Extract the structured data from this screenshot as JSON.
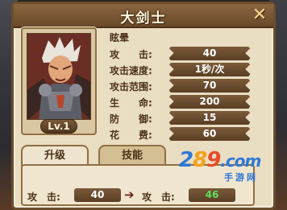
{
  "window": {
    "title": "大剑士",
    "close_symbol": "✕"
  },
  "hero": {
    "level": "Lv.1"
  },
  "skill": {
    "name": "眩晕"
  },
  "stats": [
    {
      "label": "攻　　击:",
      "value": "40"
    },
    {
      "label": "攻击速度:",
      "value": "1秒/次"
    },
    {
      "label": "攻击范围:",
      "value": "70"
    },
    {
      "label": "生　　命:",
      "value": "200"
    },
    {
      "label": "防　　御:",
      "value": "15"
    },
    {
      "label": "花　　费:",
      "value": "60"
    }
  ],
  "tabs": [
    {
      "label": "升级",
      "active": false
    },
    {
      "label": "技能",
      "active": true
    }
  ],
  "comparison": {
    "before_label": "攻　击:",
    "before_value": "40",
    "arrow": "➔",
    "after_label": "攻　击:",
    "after_value": "46",
    "after_color": "#5fe05a"
  },
  "watermark": {
    "logo_a": "2",
    "logo_b": "8",
    "logo_c": "9",
    "logo_d": ".com",
    "sub": "手游网"
  },
  "colors": {
    "panel": "#e9ddc2",
    "border": "#6c4d2b",
    "pill": "#6a4c2e"
  }
}
